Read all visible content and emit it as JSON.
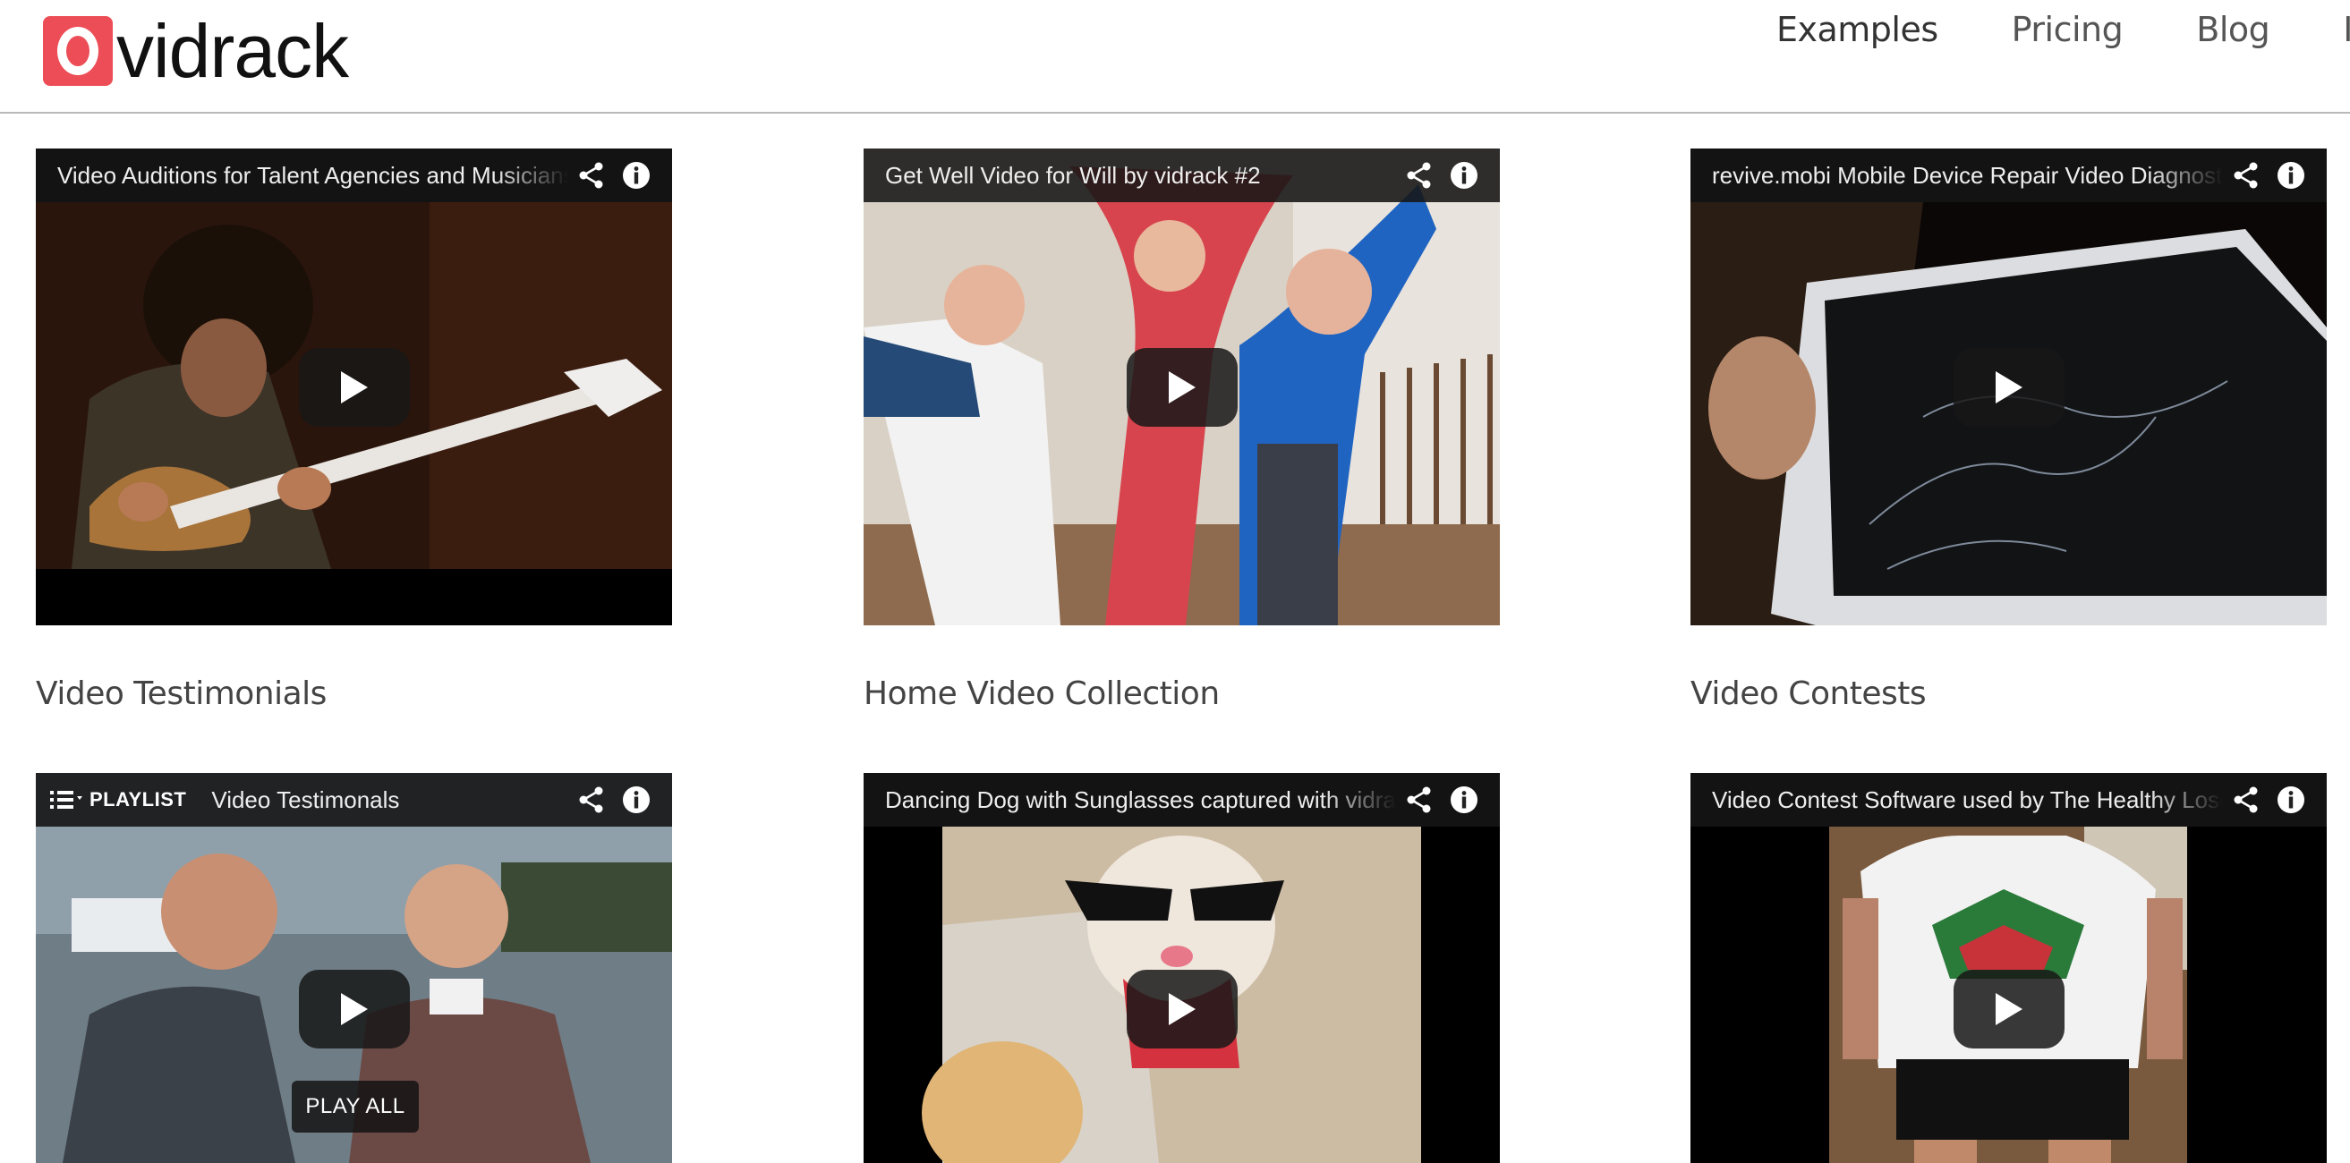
{
  "brand": {
    "name": "vidrack",
    "accent": "#ec4d57"
  },
  "nav": {
    "items": [
      "Examples",
      "Pricing",
      "Blog",
      "In"
    ]
  },
  "videos": [
    {
      "title": "Video Auditions for Talent Agencies and Musicians"
    },
    {
      "title": "Get Well Video for Will by vidrack #2"
    },
    {
      "title": "revive.mobi Mobile Device Repair Video Diagnostics"
    },
    {
      "playlist_label": "PLAYLIST",
      "title": "Video Testimonals",
      "play_all_label": "PLAY ALL"
    },
    {
      "title": "Dancing Dog with Sunglasses captured with vidrack"
    },
    {
      "title": "Video Contest Software used by The Healthy Loser"
    }
  ],
  "sections": [
    "Video Testimonials",
    "Home Video Collection",
    "Video Contests"
  ],
  "icons": {
    "share": "share-icon",
    "info": "info-icon",
    "play": "play-icon",
    "playlist": "playlist-icon"
  }
}
